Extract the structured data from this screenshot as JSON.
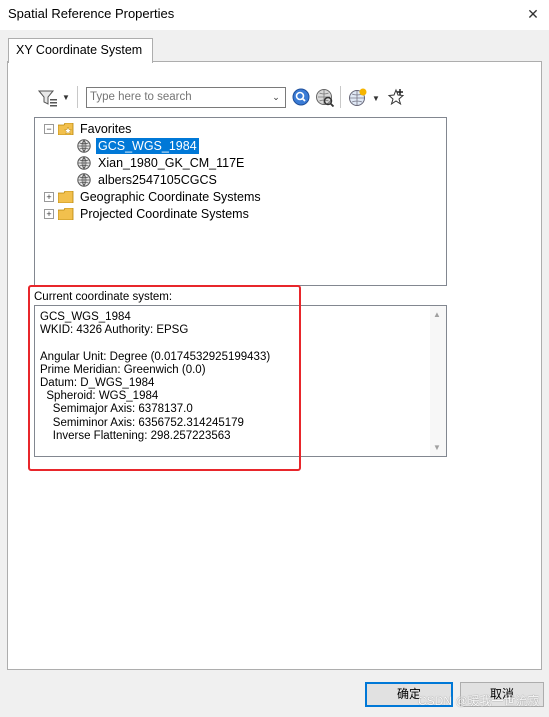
{
  "window": {
    "title": "Spatial Reference Properties",
    "close_glyph": "✕"
  },
  "tab": {
    "label": "XY Coordinate System"
  },
  "search": {
    "placeholder": "Type here to search",
    "value": ""
  },
  "tree": {
    "favorites": {
      "label": "Favorites",
      "items": [
        "GCS_WGS_1984",
        "Xian_1980_GK_CM_117E",
        "albers2547105CGCS"
      ]
    },
    "geographic": "Geographic Coordinate Systems",
    "projected": "Projected Coordinate Systems"
  },
  "current": {
    "label": "Current coordinate system:",
    "lines": "GCS_WGS_1984\nWKID: 4326 Authority: EPSG\n\nAngular Unit: Degree (0.0174532925199433)\nPrime Meridian: Greenwich (0.0)\nDatum: D_WGS_1984\n  Spheroid: WGS_1984\n    Semimajor Axis: 6378137.0\n    Semiminor Axis: 6356752.314245179\n    Inverse Flattening: 298.257223563"
  },
  "buttons": {
    "ok": "确定",
    "cancel": "取消"
  },
  "watermark": "CSDN @暖我一世流寂",
  "colors": {
    "selection": "#0078d7",
    "highlight_border": "#e8262b",
    "ok_border": "#0078d7"
  },
  "icons": [
    "filter-icon",
    "globe-search-icon",
    "globe-remove-icon",
    "globe-add-icon",
    "add-favorite-icon",
    "folder-icon",
    "globe-icon"
  ]
}
